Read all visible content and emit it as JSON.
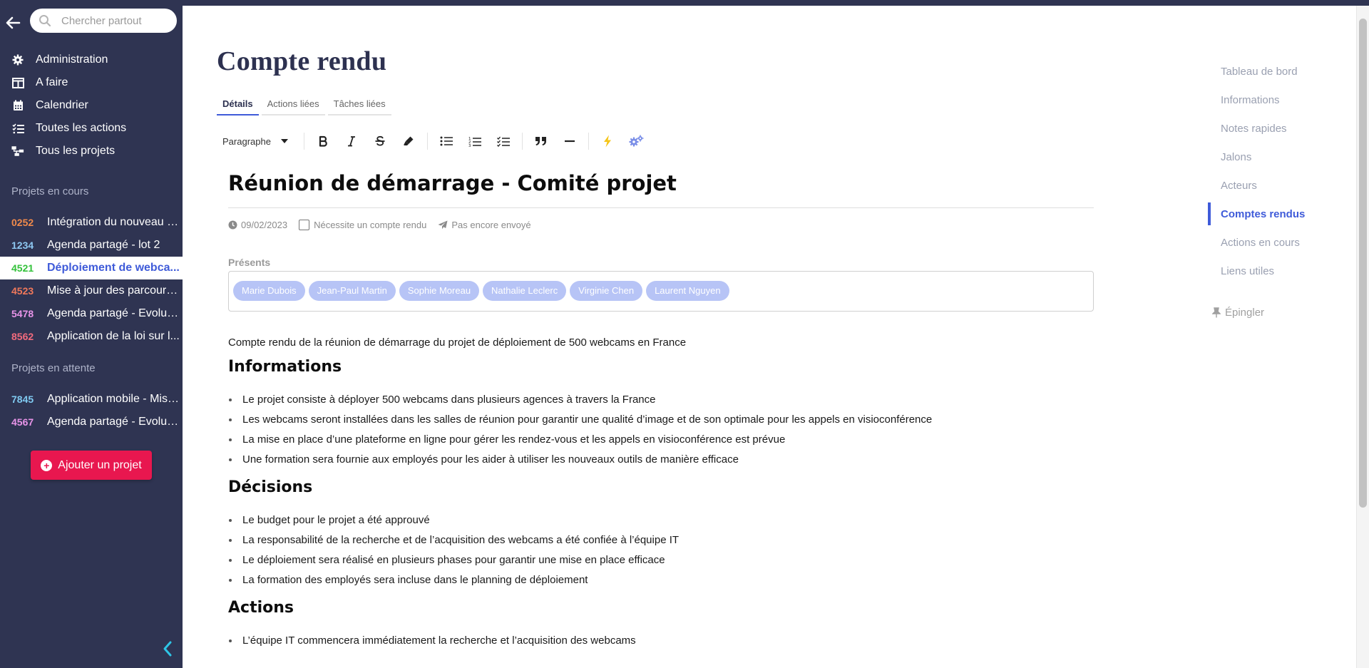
{
  "search": {
    "placeholder": "Chercher partout"
  },
  "nav": [
    {
      "label": "Administration",
      "icon": "gear-icon"
    },
    {
      "label": "A faire",
      "icon": "columns-icon"
    },
    {
      "label": "Calendrier",
      "icon": "calendar-icon"
    },
    {
      "label": "Toutes les actions",
      "icon": "checklist-icon"
    },
    {
      "label": "Tous les projets",
      "icon": "sitemap-icon"
    }
  ],
  "sections": {
    "in_progress": "Projets en cours",
    "waiting": "Projets en attente"
  },
  "projects_in_progress": [
    {
      "code": "0252",
      "name": "Intégration du nouveau p...",
      "color": "#f08a4b"
    },
    {
      "code": "1234",
      "name": "Agenda partagé - lot 2",
      "color": "#8ec8f2"
    },
    {
      "code": "4521",
      "name": "Déploiement de webca...",
      "color": "#33c23a",
      "active": true
    },
    {
      "code": "4523",
      "name": "Mise à jour des parcours ...",
      "color": "#f0785b"
    },
    {
      "code": "5478",
      "name": "Agenda partagé - Evoluti...",
      "color": "#e794e8"
    },
    {
      "code": "8562",
      "name": "Application de la loi sur l...",
      "color": "#f26b7d"
    }
  ],
  "projects_waiting": [
    {
      "code": "7845",
      "name": "Application mobile - Mise...",
      "color": "#7fc9f0"
    },
    {
      "code": "4567",
      "name": "Agenda partagé - Evoluti...",
      "color": "#e794e8"
    }
  ],
  "add_project_label": "Ajouter un projet",
  "page_title": "Compte rendu",
  "tabs": [
    {
      "label": "Détails",
      "active": true
    },
    {
      "label": "Actions liées"
    },
    {
      "label": "Tâches liées"
    }
  ],
  "toolbar": {
    "paragraph_label": "Paragraphe"
  },
  "doc": {
    "title": "Réunion de démarrage - Comité projet",
    "date": "09/02/2023",
    "needs_report": "Nécessite un compte rendu",
    "sent_status": "Pas encore envoyé",
    "presents_label": "Présents",
    "presents": [
      "Marie Dubois",
      "Jean-Paul Martin",
      "Sophie Moreau",
      "Nathalie Leclerc",
      "Virginie Chen",
      "Laurent Nguyen"
    ],
    "intro": "Compte rendu de la réunion de démarrage du projet de déploiement de 500 webcams en France",
    "sections": [
      {
        "heading": "Informations",
        "items": [
          "Le projet consiste à déployer 500 webcams dans plusieurs agences à travers la France",
          "Les webcams seront installées dans les salles de réunion pour garantir une qualité d’image et de son optimale pour les appels en visioconférence",
          "La mise en place d’une plateforme en ligne pour gérer les rendez-vous et les appels en visioconférence est prévue",
          "Une formation sera fournie aux employés pour les aider à utiliser les nouveaux outils de manière efficace"
        ]
      },
      {
        "heading": "Décisions",
        "items": [
          "Le budget pour le projet a été approuvé",
          "La responsabilité de la recherche et de l’acquisition des webcams a été confiée à l’équipe IT",
          "Le déploiement sera réalisé en plusieurs phases pour garantir une mise en place efficace",
          "La formation des employés sera incluse dans le planning de déploiement"
        ]
      },
      {
        "heading": "Actions",
        "items": [
          "L’équipe IT commencera immédiatement la recherche et l’acquisition des webcams"
        ]
      }
    ]
  },
  "right_nav": [
    {
      "label": "Tableau de bord"
    },
    {
      "label": "Informations"
    },
    {
      "label": "Notes rapides"
    },
    {
      "label": "Jalons"
    },
    {
      "label": "Acteurs"
    },
    {
      "label": "Comptes rendus",
      "active": true
    },
    {
      "label": "Actions en cours"
    },
    {
      "label": "Liens utiles"
    }
  ],
  "pin_label": "Épingler",
  "colors": {
    "sidebar": "#2f3452",
    "accent": "#3f5bd9",
    "add_button": "#e8174f",
    "chip": "#b7c4f6"
  }
}
